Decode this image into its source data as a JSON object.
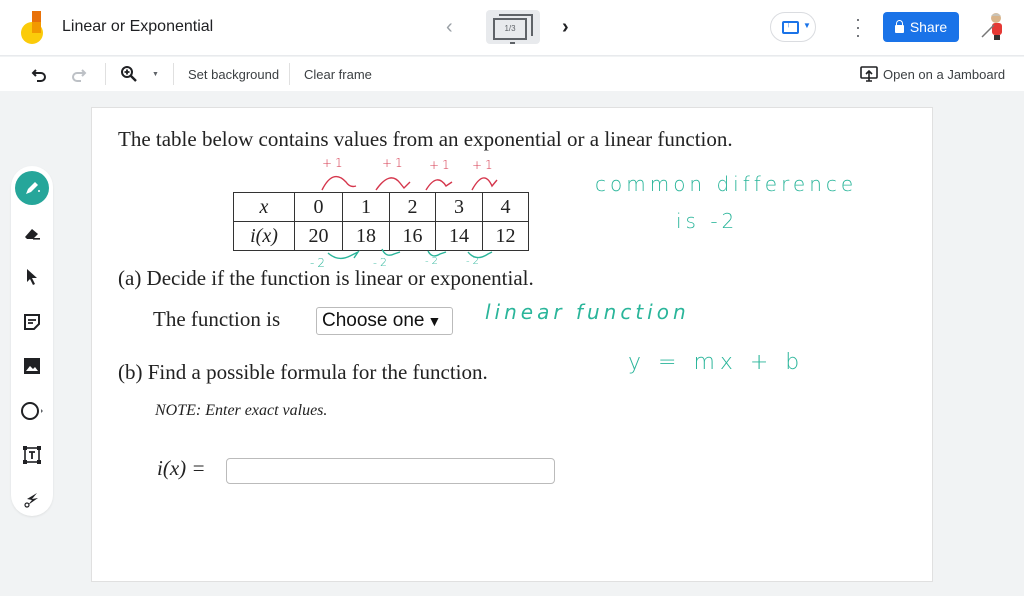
{
  "app": {
    "title": "Linear or Exponential",
    "frame_indicator": "1/3",
    "share_label": "Share",
    "colors": {
      "accent": "#1a73e8",
      "active_tool": "#26a69a",
      "ink_teal": "#2ab59a",
      "ink_red": "#d5364c"
    }
  },
  "header_icons": {
    "logo": "jamboard-logo-icon",
    "prev": "chevron-left-icon",
    "next": "chevron-right-icon",
    "frames": "frames-icon",
    "present": "present-cast-icon",
    "more": "more-vert-icon",
    "lock": "lock-icon"
  },
  "toolbar": {
    "undo": "undo-icon",
    "redo": "redo-icon",
    "zoom": "zoom-in-icon",
    "set_background": "Set background",
    "clear_frame": "Clear frame",
    "open_on_jamboard": "Open on a Jamboard"
  },
  "tools": [
    {
      "name": "pen",
      "icon": "pen-icon",
      "active": true
    },
    {
      "name": "eraser",
      "icon": "eraser-icon"
    },
    {
      "name": "select",
      "icon": "cursor-arrow-icon"
    },
    {
      "name": "sticky-note",
      "icon": "sticky-note-icon"
    },
    {
      "name": "image",
      "icon": "image-icon"
    },
    {
      "name": "shape",
      "icon": "circle-icon"
    },
    {
      "name": "text-box",
      "icon": "text-box-icon"
    },
    {
      "name": "laser",
      "icon": "laser-icon"
    }
  ],
  "question": {
    "intro": "The table below contains values from an exponential or a linear function.",
    "table": {
      "x_label": "x",
      "fx_label": "i(x)",
      "x_values": [
        "0",
        "1",
        "2",
        "3",
        "4"
      ],
      "fx_values": [
        "20",
        "18",
        "16",
        "14",
        "12"
      ]
    },
    "part_a": "(a) Decide if the function is linear or exponential.",
    "part_a_prompt": "The function is",
    "select_value": "Choose one",
    "part_b": "(b) Find a possible formula for the function.",
    "note": "NOTE: Enter exact values.",
    "answer_label": "i(x) =",
    "answer_value": ""
  },
  "annotations": {
    "plus_ones": [
      "+1",
      "+1",
      "+1",
      "+1"
    ],
    "minus_twos": [
      "-2",
      "-2",
      "-2",
      "-2"
    ],
    "common_difference_line1": "common difference",
    "common_difference_line2": "is  -2",
    "linear_function": "linear function",
    "slope_intercept": "y = mx + b"
  }
}
